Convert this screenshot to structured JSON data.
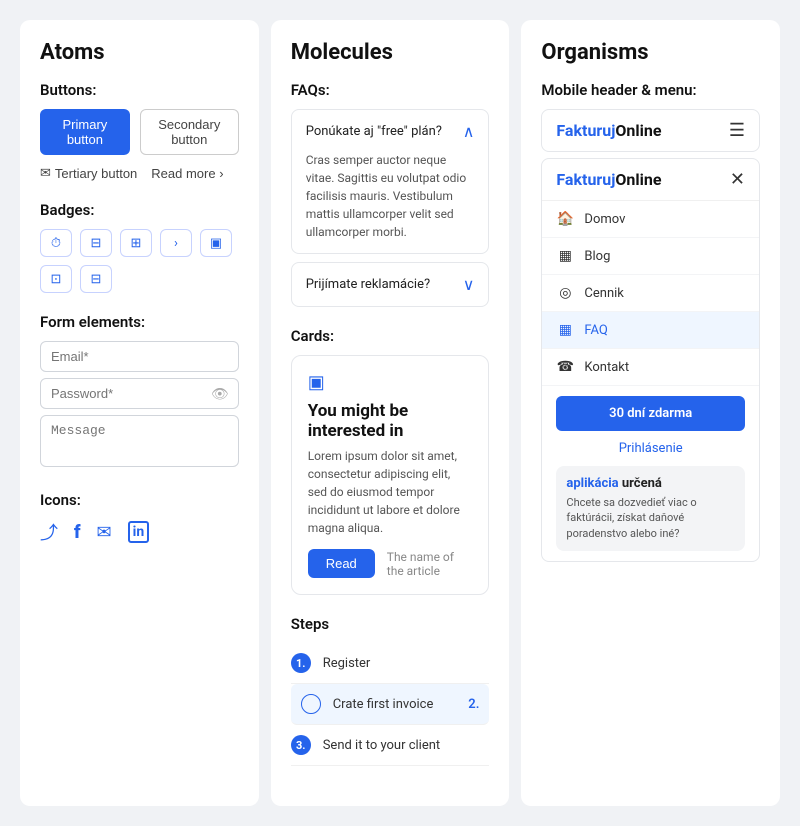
{
  "atoms": {
    "title": "Atoms",
    "buttons": {
      "label": "Buttons:",
      "primary": "Primary button",
      "secondary": "Secondary button",
      "tertiary": "Tertiary button",
      "readmore": "Read more ›"
    },
    "badges": {
      "label": "Badges:",
      "icons": [
        "⏱",
        "⊟",
        "⊞",
        "›",
        "▣",
        "⊡",
        "⊟"
      ]
    },
    "form": {
      "label": "Form elements:",
      "email_placeholder": "Email*",
      "password_placeholder": "Password*",
      "message_placeholder": "Message"
    },
    "icons": {
      "label": "Icons:",
      "items": [
        "⤴",
        "f",
        "✉",
        "in"
      ]
    }
  },
  "molecules": {
    "title": "Molecules",
    "faqs": {
      "label": "FAQs:",
      "items": [
        {
          "question": "Ponúkate aj \"free\" plán?",
          "answer": "Cras semper auctor neque vitae. Sagittis eu volutpat odio facilisis mauris. Vestibulum mattis ullamcorper velit sed ullamcorper morbi.",
          "open": true
        },
        {
          "question": "Prijímate reklamácie?",
          "answer": "",
          "open": false
        }
      ]
    },
    "cards": {
      "label": "Cards:",
      "title": "You might be interested in",
      "body": "Lorem ipsum dolor sit amet, consectetur adipiscing elit, sed do eiusmod tempor incididunt ut labore et dolore magna aliqua.",
      "btn": "Read",
      "link": "The name of the article"
    },
    "steps": {
      "label": "Steps",
      "items": [
        {
          "num": "1.",
          "label": "Register",
          "num_right": ""
        },
        {
          "num": "2.",
          "label": "Crate first invoice",
          "num_right": "2."
        },
        {
          "num": "3.",
          "label": "Send it to your client",
          "num_right": ""
        }
      ]
    }
  },
  "organisms": {
    "title": "Organisms",
    "mobile_header": {
      "label": "Mobile header & menu:",
      "logo1": "FakturujOnline",
      "logo2": "FakturujOnline",
      "logo_blue": "Fakturuj",
      "logo_black": "Online",
      "nav_items": [
        {
          "icon": "🏠",
          "label": "Domov",
          "active": false
        },
        {
          "icon": "▦",
          "label": "Blog",
          "active": false
        },
        {
          "icon": "◎",
          "label": "Cennik",
          "active": false
        },
        {
          "icon": "▦",
          "label": "FAQ",
          "active": true
        },
        {
          "icon": "☎",
          "label": "Kontakt",
          "active": false
        }
      ],
      "cta": "30 dní zdarma",
      "login": "Prihlásenie",
      "promo_title_blue": "aplikácia",
      "promo_title_black": " určená",
      "promo_body": "Chcete sa dozvedieť viac o faktúrácii, získat daňové poradenstvo alebo iné?"
    }
  }
}
